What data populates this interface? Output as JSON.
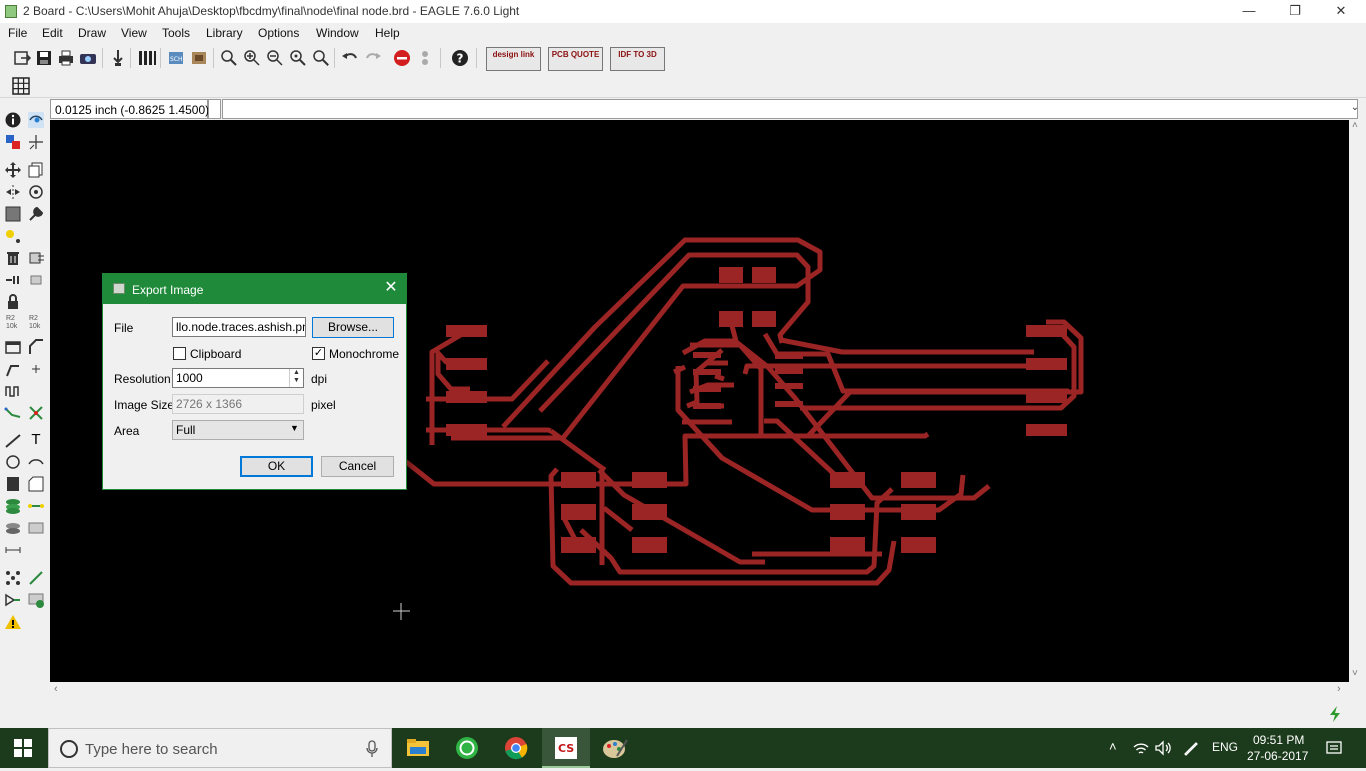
{
  "window": {
    "title": "2 Board - C:\\Users\\Mohit Ahuja\\Desktop\\fbcdmy\\final\\node\\final node.brd - EAGLE 7.6.0 Light",
    "min_glyph": "—",
    "max_glyph": "❐",
    "close_glyph": "✕"
  },
  "menu": [
    "File",
    "Edit",
    "Draw",
    "View",
    "Tools",
    "Library",
    "Options",
    "Window",
    "Help"
  ],
  "toolbar": {
    "design_link_label": "design link",
    "pcb_quote_label": "PCB QUOTE",
    "idf_label": "IDF TO 3D"
  },
  "coordinates": "0.0125 inch (-0.8625 1.4500)",
  "dialog": {
    "title": "Export Image",
    "close_glyph": "✕",
    "file_label": "File",
    "file_value": "llo.node.traces.ashish.png",
    "browse_label": "Browse...",
    "clipboard_label": "Clipboard",
    "clipboard_checked": false,
    "monochrome_label": "Monochrome",
    "monochrome_checked": true,
    "resolution_label": "Resolution",
    "resolution_value": "1000",
    "resolution_unit": "dpi",
    "image_size_label": "Image Size",
    "image_size_value": "2726 x 1366",
    "image_size_unit": "pixel",
    "area_label": "Area",
    "area_value": "Full",
    "ok_label": "OK",
    "cancel_label": "Cancel"
  },
  "palette": {
    "label_r2_10k": "R2 10k",
    "label_r2_10k_b": "R2 10k",
    "text_tool_glyph": "T"
  },
  "taskbar": {
    "search_placeholder": "Type here to search",
    "language": "ENG",
    "time": "09:51 PM",
    "date": "27-06-2017"
  },
  "colors": {
    "trace": "#9b2424",
    "canvas": "#000000",
    "dialog_title": "#1f8b3a"
  }
}
